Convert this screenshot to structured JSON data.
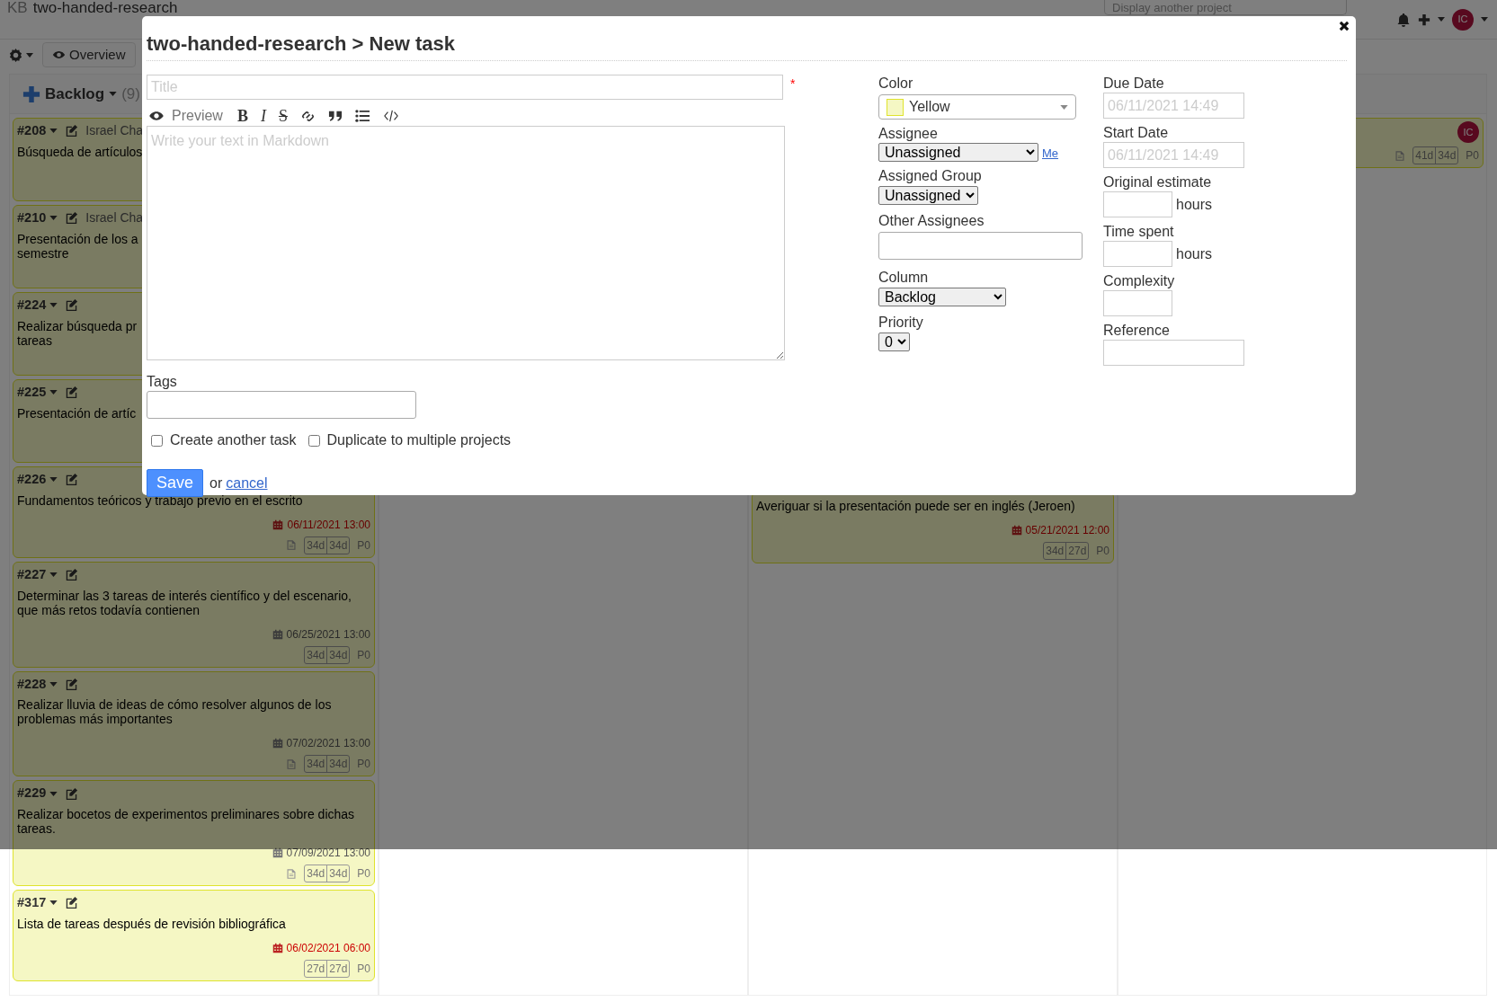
{
  "header": {
    "logo": "KB",
    "project": "two-handed-research",
    "project_select_placeholder": "Display another project",
    "avatar": "IC"
  },
  "toolbar": {
    "overview": "Overview"
  },
  "board": {
    "columns": [
      {
        "title": "Backlog",
        "count": "(9)",
        "tasks": [
          {
            "id": "#208",
            "assignee": "Israel Cha",
            "title_lines": [
              "Búsqueda de artículos"
            ]
          },
          {
            "id": "#210",
            "assignee": "Israel Cha",
            "title_lines": [
              "Presentación de los a",
              "semestre"
            ]
          },
          {
            "id": "#224",
            "title_lines": [
              "Realizar búsqueda pr",
              "tareas"
            ]
          },
          {
            "id": "#225",
            "title_lines": [
              "Presentación de artíc"
            ]
          },
          {
            "id": "#226",
            "title_lines": [
              "Fundamentos teóricos y trabajo previo en el escrito"
            ],
            "due": "06/11/2021 13:00",
            "overdue": true,
            "has_description": true,
            "times": [
              "34d",
              "34d"
            ],
            "priority": "P0"
          },
          {
            "id": "#227",
            "title_lines": [
              "Determinar las 3 tareas de interés científico y del escenario,",
              "que más retos todavía contienen"
            ],
            "due": "06/25/2021 13:00",
            "overdue": false,
            "has_description": false,
            "times": [
              "34d",
              "34d"
            ],
            "priority": "P0"
          },
          {
            "id": "#228",
            "title_lines": [
              "Realizar lluvia de ideas de cómo resolver algunos de los",
              "problemas más importantes"
            ],
            "due": "07/02/2021 13:00",
            "overdue": false,
            "has_description": true,
            "times": [
              "34d",
              "34d"
            ],
            "priority": "P0"
          },
          {
            "id": "#229",
            "title_lines": [
              "Realizar bocetos de experimentos preliminares sobre dichas",
              "tareas."
            ],
            "due": "07/09/2021 13:00",
            "overdue": false,
            "has_description": true,
            "times": [
              "34d",
              "34d"
            ],
            "priority": "P0"
          },
          {
            "id": "#317",
            "title_lines": [
              "Lista de tareas después de revisión bibliográfica"
            ],
            "due": "06/02/2021 06:00",
            "overdue": true,
            "has_description": false,
            "times": [
              "27d",
              "27d"
            ],
            "priority": "P0"
          }
        ]
      },
      {},
      {
        "tasks": [
          {
            "title_lines": [
              "Averiguar si la presentación puede ser en inglés (Jeroen)"
            ],
            "due": "05/21/2021 12:00",
            "overdue": true,
            "has_description": false,
            "times": [
              "34d",
              "27d"
            ],
            "priority": "P0"
          }
        ]
      },
      {
        "tasks": [
          {
            "avatar": "IC",
            "has_description": true,
            "times": [
              "41d",
              "34d"
            ],
            "priority": "P0"
          }
        ]
      }
    ]
  },
  "modal": {
    "title": "two-handed-research > New task",
    "title_placeholder": "Title",
    "required_mark": "*",
    "tools": [
      {
        "kind": "preview",
        "label": "Preview"
      },
      {
        "kind": "bold",
        "glyph": "B"
      },
      {
        "kind": "italic",
        "glyph": "I"
      },
      {
        "kind": "strike",
        "glyph": "S"
      },
      {
        "kind": "link"
      },
      {
        "kind": "quote"
      },
      {
        "kind": "list"
      },
      {
        "kind": "code"
      }
    ],
    "editor_placeholder": "Write your text in Markdown",
    "tags_label": "Tags",
    "checkboxes": [
      {
        "label": "Create another task",
        "checked": false
      },
      {
        "label": "Duplicate to multiple projects",
        "checked": false
      }
    ],
    "save": "Save",
    "or": "or",
    "cancel": "cancel",
    "color": {
      "label": "Color",
      "value": "Yellow",
      "color": "#f5f7c4"
    },
    "assignee": {
      "label": "Assignee",
      "value": "Unassigned",
      "me": "Me"
    },
    "assigned_group": {
      "label": "Assigned Group",
      "value": "Unassigned"
    },
    "other_assignees": {
      "label": "Other Assignees"
    },
    "column": {
      "label": "Column",
      "value": "Backlog"
    },
    "priority": {
      "label": "Priority",
      "value": "0"
    },
    "due_date": {
      "label": "Due Date",
      "placeholder": "06/11/2021 14:49"
    },
    "start_date": {
      "label": "Start Date",
      "placeholder": "06/11/2021 14:49"
    },
    "original_estimate": {
      "label": "Original estimate",
      "unit": "hours"
    },
    "time_spent": {
      "label": "Time spent",
      "unit": "hours"
    },
    "complexity": {
      "label": "Complexity"
    },
    "reference": {
      "label": "Reference"
    }
  }
}
